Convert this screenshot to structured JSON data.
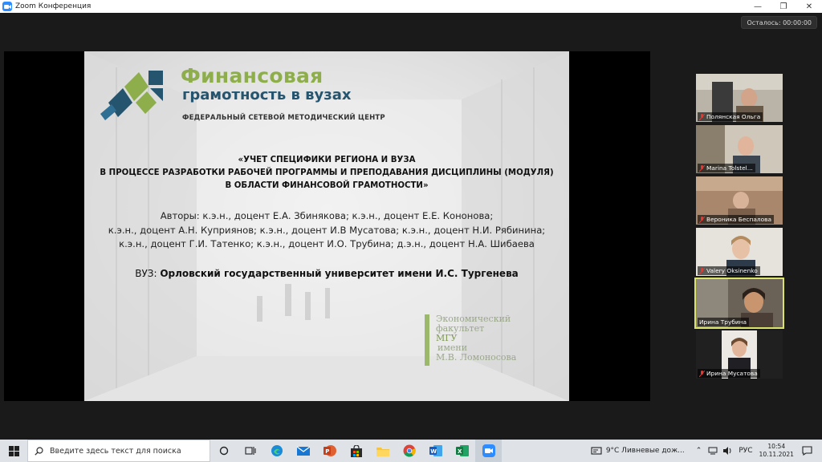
{
  "window": {
    "title": "Zoom Конференция"
  },
  "timer": {
    "label": "Осталось: 00:00:00"
  },
  "slide": {
    "brand_line1": "Финансовая",
    "brand_line2": "грамотность в вузах",
    "brand_line3": "ФЕДЕРАЛЬНЫЙ СЕТЕВОЙ МЕТОДИЧЕСКИЙ ЦЕНТР",
    "title_lines": [
      "«УЧЕТ СПЕЦИФИКИ РЕГИОНА И ВУЗА",
      "В ПРОЦЕССЕ РАЗРАБОТКИ РАБОЧЕЙ ПРОГРАММЫ И ПРЕПОДАВАНИЯ ДИСЦИПЛИНЫ (МОДУЛЯ)",
      "В ОБЛАСТИ ФИНАНСОВОЙ ГРАМОТНОСТИ»"
    ],
    "authors_lines": [
      "Авторы: к.э.н., доцент Е.А. Збинякова; к.э.н., доцент Е.Е. Кононова;",
      "к.э.н., доцент А.Н. Куприянов; к.э.н., доцент И.В Мусатова; к.э.н., доцент Н.И. Рябинина;",
      "к.э.н., доцент Г.И. Татенко; к.э.н., доцент И.О. Трубина; д.э.н., доцент  Н.А. Шибаева"
    ],
    "vuz_label": "ВУЗ: ",
    "vuz_name": "Орловский государственный университет имени И.С. Тургенева",
    "econ_lines": [
      "Экономический",
      "факультет",
      "МГУ",
      "имени",
      "М.В. Ломоносова"
    ]
  },
  "participants": [
    {
      "name": "Полянская Ольга",
      "muted": true,
      "active": false
    },
    {
      "name": "Marina Tolstel...",
      "muted": true,
      "active": false
    },
    {
      "name": "Вероника Беспалова",
      "muted": true,
      "active": false
    },
    {
      "name": "Valery Oksinenko",
      "muted": true,
      "active": false
    },
    {
      "name": "Ирина Трубина",
      "muted": false,
      "active": true
    },
    {
      "name": "Ирина Мусатова",
      "muted": true,
      "active": false
    }
  ],
  "taskbar": {
    "search_placeholder": "Введите здесь текст для поиска",
    "weather": "9°C  Ливневые дож...",
    "lang": "РУС",
    "time": "10:54",
    "date": "10.11.2021",
    "apps": [
      "task-view",
      "edge",
      "mail",
      "powerpoint",
      "store",
      "explorer",
      "chrome",
      "word",
      "excel",
      "zoom"
    ]
  },
  "colors": {
    "accent_green": "#8dae4a",
    "accent_blue": "#25546f",
    "speaker_outline": "#d9e26a",
    "muted_red": "#e53935"
  }
}
